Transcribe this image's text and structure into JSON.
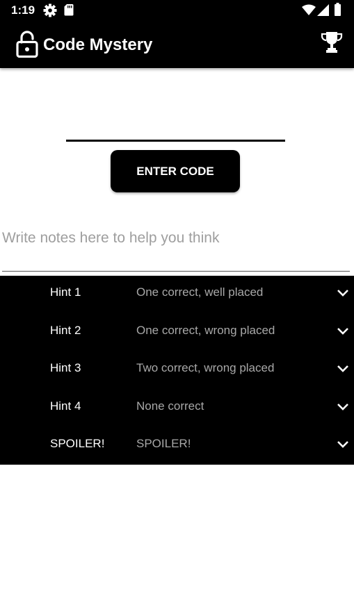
{
  "status_bar": {
    "time": "1:19",
    "icons": [
      "settings-icon",
      "sd-card-icon",
      "wifi-icon",
      "signal-icon",
      "battery-icon"
    ]
  },
  "app_bar": {
    "title": "Code Mystery",
    "left_icon": "lock-open-icon",
    "right_icon": "trophy-icon"
  },
  "code_entry": {
    "value": "",
    "button_label": "ENTER CODE"
  },
  "notes": {
    "value": "",
    "placeholder": "Write notes here to help you think"
  },
  "hints": [
    {
      "label": "Hint 1",
      "value": "One correct, well placed"
    },
    {
      "label": "Hint 2",
      "value": "One correct, wrong placed"
    },
    {
      "label": "Hint 3",
      "value": "Two correct, wrong placed"
    },
    {
      "label": "Hint 4",
      "value": "None correct"
    },
    {
      "label": "SPOILER!",
      "value": "SPOILER!"
    }
  ],
  "colors": {
    "app_bar": "#000000",
    "hint_panel": "#000000",
    "hint_text": "#ffffff",
    "hint_value_text": "#a8a8a8",
    "placeholder": "#9e9e9e"
  }
}
